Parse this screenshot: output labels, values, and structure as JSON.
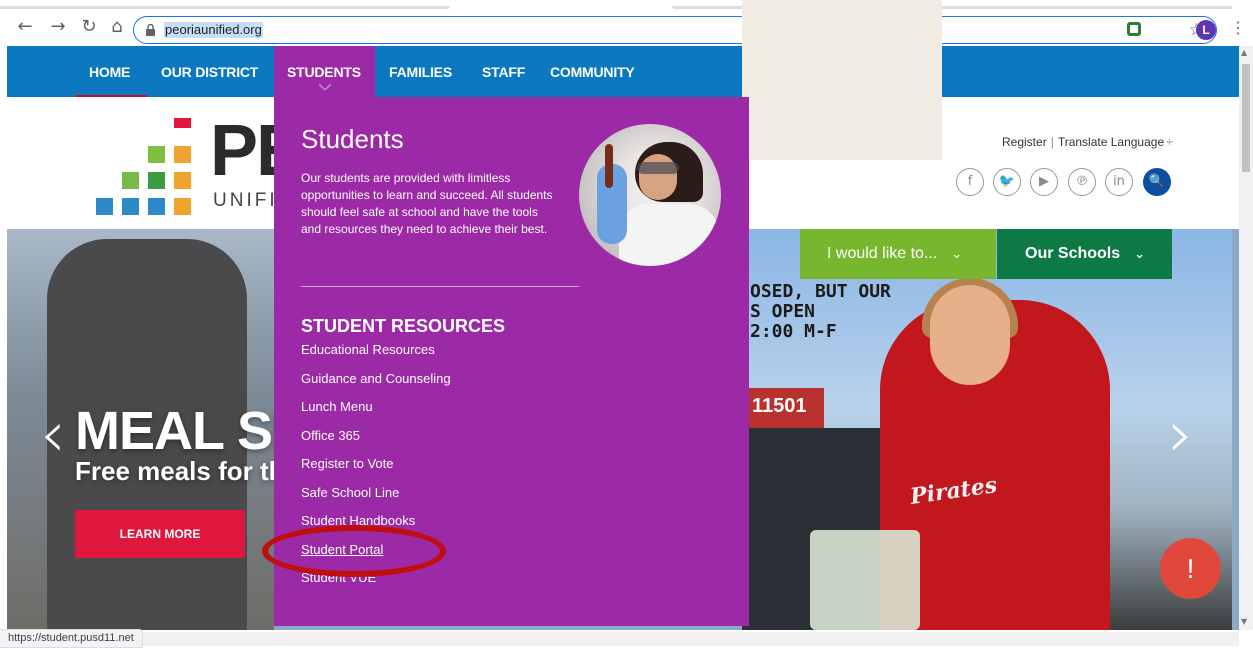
{
  "browser": {
    "url": "peoriaunified.org",
    "profile_initial": "L",
    "status_url": "https://student.pusd11.net"
  },
  "topnav": {
    "items": [
      "HOME",
      "OUR DISTRICT",
      "STUDENTS",
      "FAMILIES",
      "STAFF",
      "COMMUNITY"
    ]
  },
  "header": {
    "logo_big": "PE",
    "logo_small": "UNIFIE",
    "register": "Register",
    "translate": "Translate Language",
    "translate_symbol": "÷",
    "social_icons": [
      "facebook-icon",
      "twitter-icon",
      "youtube-icon",
      "pinterest-icon",
      "linkedin-icon",
      "search-icon"
    ],
    "social_glyphs": [
      "f",
      "🐦",
      "▶",
      "℗",
      "in",
      "🔍"
    ]
  },
  "hero": {
    "title": "MEAL SER",
    "subtitle": "Free meals for th",
    "learn_more": "LEARN MORE",
    "marquee": "OSED, BUT OUR\nS OPEN\n2:00 M-F",
    "sign_number": "11501",
    "shirt_text": "Pirates",
    "would_like": "I would like to...",
    "our_schools": "Our Schools",
    "prev_arrow": "‹",
    "next_arrow": "›",
    "alert": "!"
  },
  "dropdown": {
    "title": "Students",
    "description": "Our students are provided with limitless opportunities to learn and succeed. All students should feel safe at school and have the tools and resources they need to achieve their best.",
    "heading": "STUDENT RESOURCES",
    "links": [
      "Educational Resources",
      "Guidance and Counseling",
      "Lunch Menu",
      "Office 365",
      "Register to Vote",
      "Safe School Line",
      "Student Handbooks",
      "Student Portal",
      "Student VUE"
    ]
  },
  "colors": {
    "nav_blue": "#0b78bf",
    "dropdown_purple": "#9c2aa6",
    "accent_red": "#c8102e",
    "learn_more_red": "#e0173d",
    "wouldlike_green": "#78b72d",
    "schools_green": "#0d7a46",
    "highlight_red": "#c00d0d"
  }
}
